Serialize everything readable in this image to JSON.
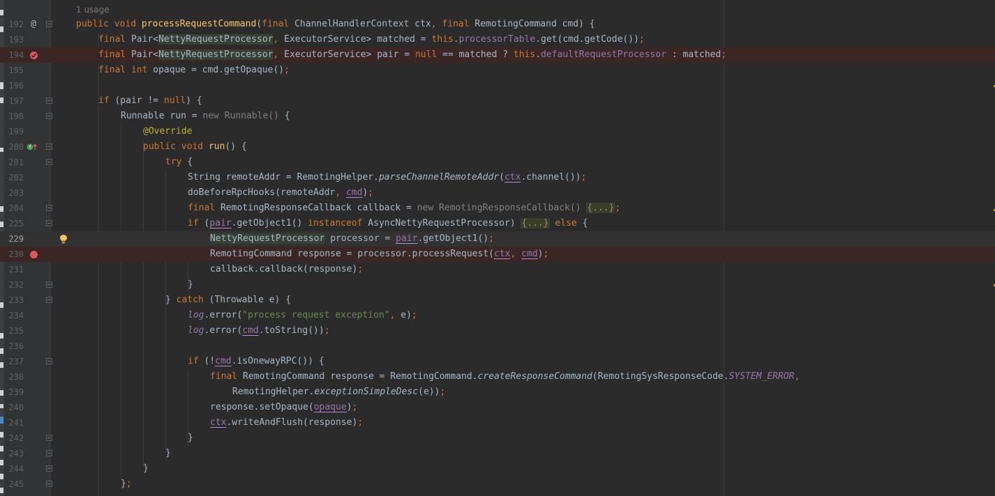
{
  "editor": {
    "usage_hint": "1 usage",
    "lines": [
      {
        "num": "192",
        "text": "public void processRequestCommand(final ChannelHandlerContext ctx, final RemotingCommand cmd) {"
      },
      {
        "num": "193",
        "text": "final Pair<NettyRequestProcessor, ExecutorService> matched = this.processorTable.get(cmd.getCode());"
      },
      {
        "num": "194",
        "text": "final Pair<NettyRequestProcessor, ExecutorService> pair = null == matched ? this.defaultRequestProcessor : matched;"
      },
      {
        "num": "195",
        "text": "final int opaque = cmd.getOpaque();"
      },
      {
        "num": "196",
        "text": ""
      },
      {
        "num": "197",
        "text": "if (pair != null) {"
      },
      {
        "num": "198",
        "text": "Runnable run = new Runnable() {"
      },
      {
        "num": "199",
        "text": "@Override"
      },
      {
        "num": "200",
        "text": "public void run() {"
      },
      {
        "num": "201",
        "text": "try {"
      },
      {
        "num": "202",
        "text": "String remoteAddr = RemotingHelper.parseChannelRemoteAddr(ctx.channel());"
      },
      {
        "num": "203",
        "text": "doBeforeRpcHooks(remoteAddr, cmd);"
      },
      {
        "num": "204",
        "text": "final RemotingResponseCallback callback = new RemotingResponseCallback() {...};"
      },
      {
        "num": "225",
        "text": "if (pair.getObject1() instanceof AsyncNettyRequestProcessor) {...} else {"
      },
      {
        "num": "229",
        "text": "NettyRequestProcessor processor = pair.getObject1();"
      },
      {
        "num": "230",
        "text": "RemotingCommand response = processor.processRequest(ctx, cmd);"
      },
      {
        "num": "231",
        "text": "callback.callback(response);"
      },
      {
        "num": "232",
        "text": "}"
      },
      {
        "num": "233",
        "text": "} catch (Throwable e) {"
      },
      {
        "num": "234",
        "text": "log.error(\"process request exception\", e);"
      },
      {
        "num": "235",
        "text": "log.error(cmd.toString());"
      },
      {
        "num": "236",
        "text": ""
      },
      {
        "num": "237",
        "text": "if (!cmd.isOnewayRPC()) {"
      },
      {
        "num": "238",
        "text": "final RemotingCommand response = RemotingCommand.createResponseCommand(RemotingSysResponseCode.SYSTEM_ERROR,"
      },
      {
        "num": "239",
        "text": "RemotingHelper.exceptionSimpleDesc(e));"
      },
      {
        "num": "240",
        "text": "response.setOpaque(opaque);"
      },
      {
        "num": "241",
        "text": "ctx.writeAndFlush(response);"
      },
      {
        "num": "242",
        "text": "}"
      },
      {
        "num": "243",
        "text": "}"
      },
      {
        "num": "244",
        "text": "}"
      },
      {
        "num": "245",
        "text": "};"
      }
    ]
  },
  "gutter_icons": {
    "line_192": "implementation-marker-icon",
    "line_194": "breakpoint-disabled-icon",
    "line_200": "override-method-icon",
    "line_229": "intention-bulb-icon",
    "line_230": "breakpoint-icon"
  },
  "colors": {
    "keyword": "#cc7832",
    "method_decl": "#ffc66d",
    "string": "#6a8759",
    "annotation": "#bbb529",
    "field": "#9876aa",
    "breakpoint_line": "#3b2626",
    "breakpoint": "#db5860",
    "background": "#2b2b2b"
  }
}
